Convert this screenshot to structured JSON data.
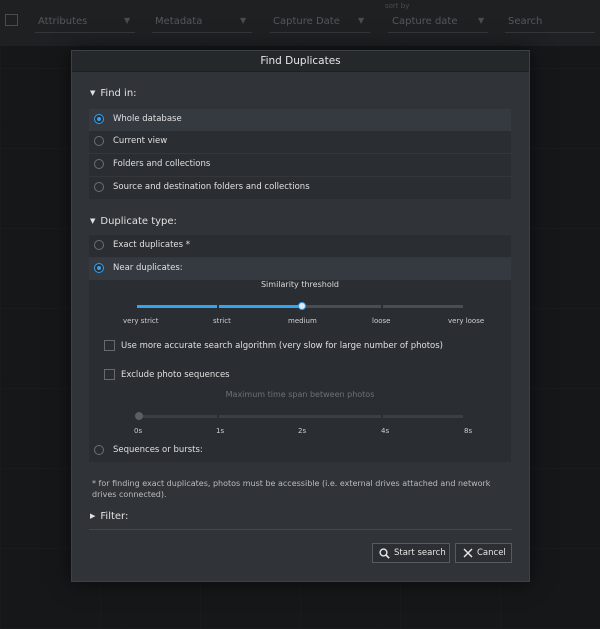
{
  "background_toolbar": {
    "items": [
      "Attributes",
      "Metadata",
      "Capture Date",
      "Capture date",
      "Search"
    ],
    "small_label": "sort by"
  },
  "dialog": {
    "title": "Find Duplicates",
    "find_in": {
      "title": "Find in:",
      "options": [
        {
          "label": "Whole database",
          "selected": true
        },
        {
          "label": "Current view",
          "selected": false
        },
        {
          "label": "Folders and collections",
          "selected": false
        },
        {
          "label": "Source and destination folders and collections",
          "selected": false
        }
      ]
    },
    "duplicate_type": {
      "title": "Duplicate type:",
      "exact": {
        "label": "Exact duplicates *",
        "selected": false
      },
      "near": {
        "label": "Near duplicates:",
        "selected": true
      },
      "similarity": {
        "title": "Similarity threshold",
        "ticks": [
          "very strict",
          "strict",
          "medium",
          "loose",
          "very loose"
        ],
        "value": "medium",
        "value_index": 2
      },
      "accurate_algorithm": {
        "label": "Use more accurate search algorithm (very slow for large number of photos)",
        "checked": false
      },
      "exclude_sequences": {
        "label": "Exclude photo sequences",
        "checked": false
      },
      "time_span": {
        "title": "Maximum time span between photos",
        "ticks": [
          "0s",
          "1s",
          "2s",
          "4s",
          "8s"
        ],
        "value": "0s",
        "value_index": 0,
        "enabled": false
      },
      "sequences": {
        "label": "Sequences or bursts:",
        "selected": false
      }
    },
    "footnote": "* for finding exact duplicates, photos must be accessible (i.e. external drives attached and network drives connected).",
    "filter": {
      "title": "Filter:"
    },
    "buttons": {
      "search": {
        "label": "Start search",
        "icon": "search-icon"
      },
      "cancel": {
        "label": "Cancel",
        "icon": "close-icon"
      }
    }
  },
  "colors": {
    "accent": "#33a3f4",
    "dialog_bg": "#303337",
    "panel_bg": "#2a2d31"
  }
}
